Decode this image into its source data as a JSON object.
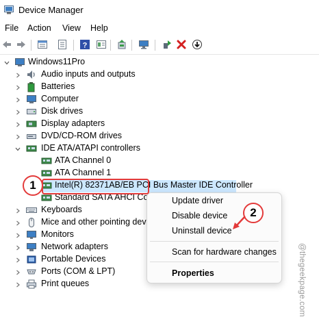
{
  "window": {
    "title": "Device Manager"
  },
  "menu": [
    "File",
    "Action",
    "View",
    "Help"
  ],
  "toolbar_icons": [
    "back-icon",
    "forward-icon",
    "properties-icon",
    "update-list-icon",
    "help-icon",
    "view-icon",
    "scan-hardware-icon",
    "monitor-icon",
    "enable-device-icon",
    "uninstall-icon",
    "download-driver-icon"
  ],
  "tree": {
    "root": "Windows11Pro",
    "categories": [
      "Audio inputs and outputs",
      "Batteries",
      "Computer",
      "Disk drives",
      "Display adapters",
      "DVD/CD-ROM drives",
      "IDE ATA/ATAPI controllers",
      "Keyboards",
      "Mice and other pointing devi",
      "Monitors",
      "Network adapters",
      "Portable Devices",
      "Ports (COM & LPT)",
      "Print queues"
    ],
    "ide_children": [
      "ATA Channel 0",
      "ATA Channel 1",
      "Intel(R) 82371AB/EB PCI Bus Master IDE Controller",
      "Standard SATA AHCI Contr"
    ]
  },
  "context_menu": {
    "items": [
      "Update driver",
      "Disable device",
      "Uninstall device",
      "Scan for hardware changes",
      "Properties"
    ]
  },
  "callouts": [
    "1",
    "2"
  ],
  "watermark": "@thegeekpage.com",
  "colors": {
    "selection": "#cce8ff",
    "callout": "#e33a3a"
  }
}
